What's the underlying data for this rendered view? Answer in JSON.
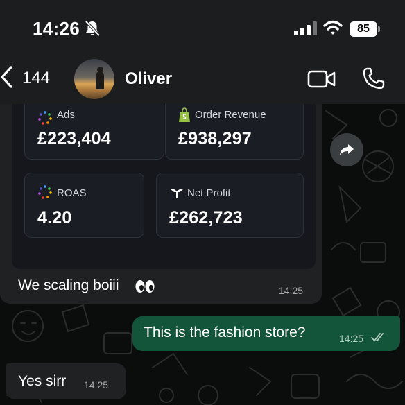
{
  "status_bar": {
    "time": "14:26",
    "battery": "85",
    "icons": [
      "bell-slash-icon",
      "signal-icon",
      "wifi-icon",
      "battery-icon"
    ]
  },
  "header": {
    "back_count": "144",
    "contact_name": "Oliver",
    "icons": [
      "chevron-left-icon",
      "video-call-icon",
      "phone-icon"
    ]
  },
  "dashboard": {
    "ads": {
      "label": "Ads",
      "value": "£223,404",
      "icon": "meta-dots-icon"
    },
    "order_revenue": {
      "label": "Order Revenue",
      "value": "£938,297",
      "icon": "shopify-bag-icon"
    },
    "roas": {
      "label": "ROAS",
      "value": "4.20",
      "icon": "meta-dots-icon"
    },
    "net_profit": {
      "label": "Net Profit",
      "value": "£262,723",
      "icon": "triple-whale-icon"
    }
  },
  "messages": [
    {
      "direction": "incoming",
      "text": "We scaling boiii",
      "emoji": "eyes-emoji",
      "time": "14:25"
    },
    {
      "direction": "outgoing",
      "text": "This is the fashion store?",
      "time": "14:25",
      "status": "read-double-tick"
    },
    {
      "direction": "incoming",
      "text": "Yes sirr",
      "time": "14:25"
    }
  ],
  "colors": {
    "outgoing_bubble": "#13553a",
    "incoming_bubble": "#1f2123",
    "header_bg": "#1b1d1e"
  }
}
